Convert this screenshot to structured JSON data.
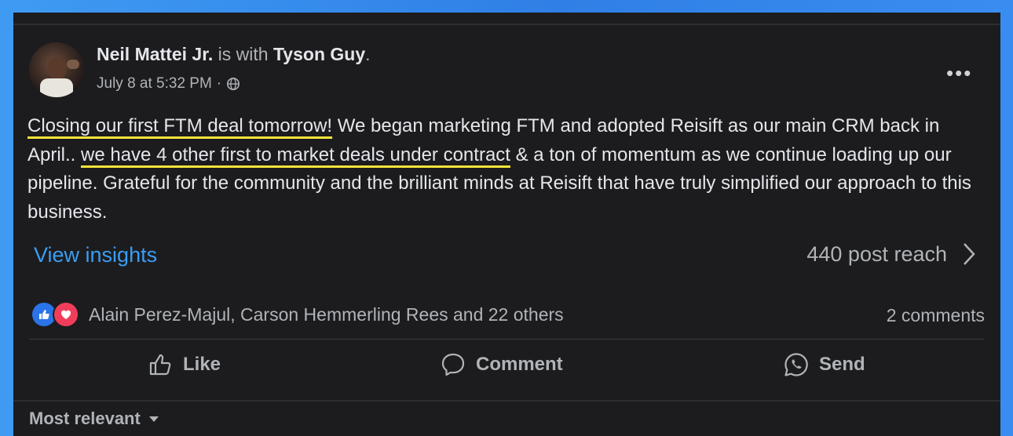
{
  "post": {
    "author": "Neil Mattei Jr.",
    "with_text": "is with",
    "tagged": "Tyson Guy",
    "period": ".",
    "timestamp": "July 8 at 5:32 PM",
    "separator": "·",
    "privacy_icon": "globe-icon",
    "more_label": "•••",
    "body": {
      "hl1": "Closing our first FTM deal tomorrow!",
      "t1": " We began marketing FTM and adopted Reisift as our main CRM back in April.. ",
      "hl2": "we have 4 other first to market deals under contract",
      "t2": " & a ton of momentum as we continue loading up our pipeline. Grateful for the community and the brilliant minds at Reisift that have truly simplified our approach to this business."
    },
    "insights_label": "View insights",
    "reach_label": "440 post reach",
    "reactors": "Alain Perez-Majul, Carson Hemmerling Rees and 22 others",
    "comments": "2 comments",
    "actions": {
      "like": "Like",
      "comment": "Comment",
      "send": "Send"
    },
    "sort_label": "Most relevant"
  },
  "colors": {
    "accent_link": "#3b9cf4",
    "highlight_underline": "#f4e33b",
    "like_blue": "#2a74e8",
    "love_red": "#f03e5a",
    "card_bg": "#1c1c1e"
  }
}
